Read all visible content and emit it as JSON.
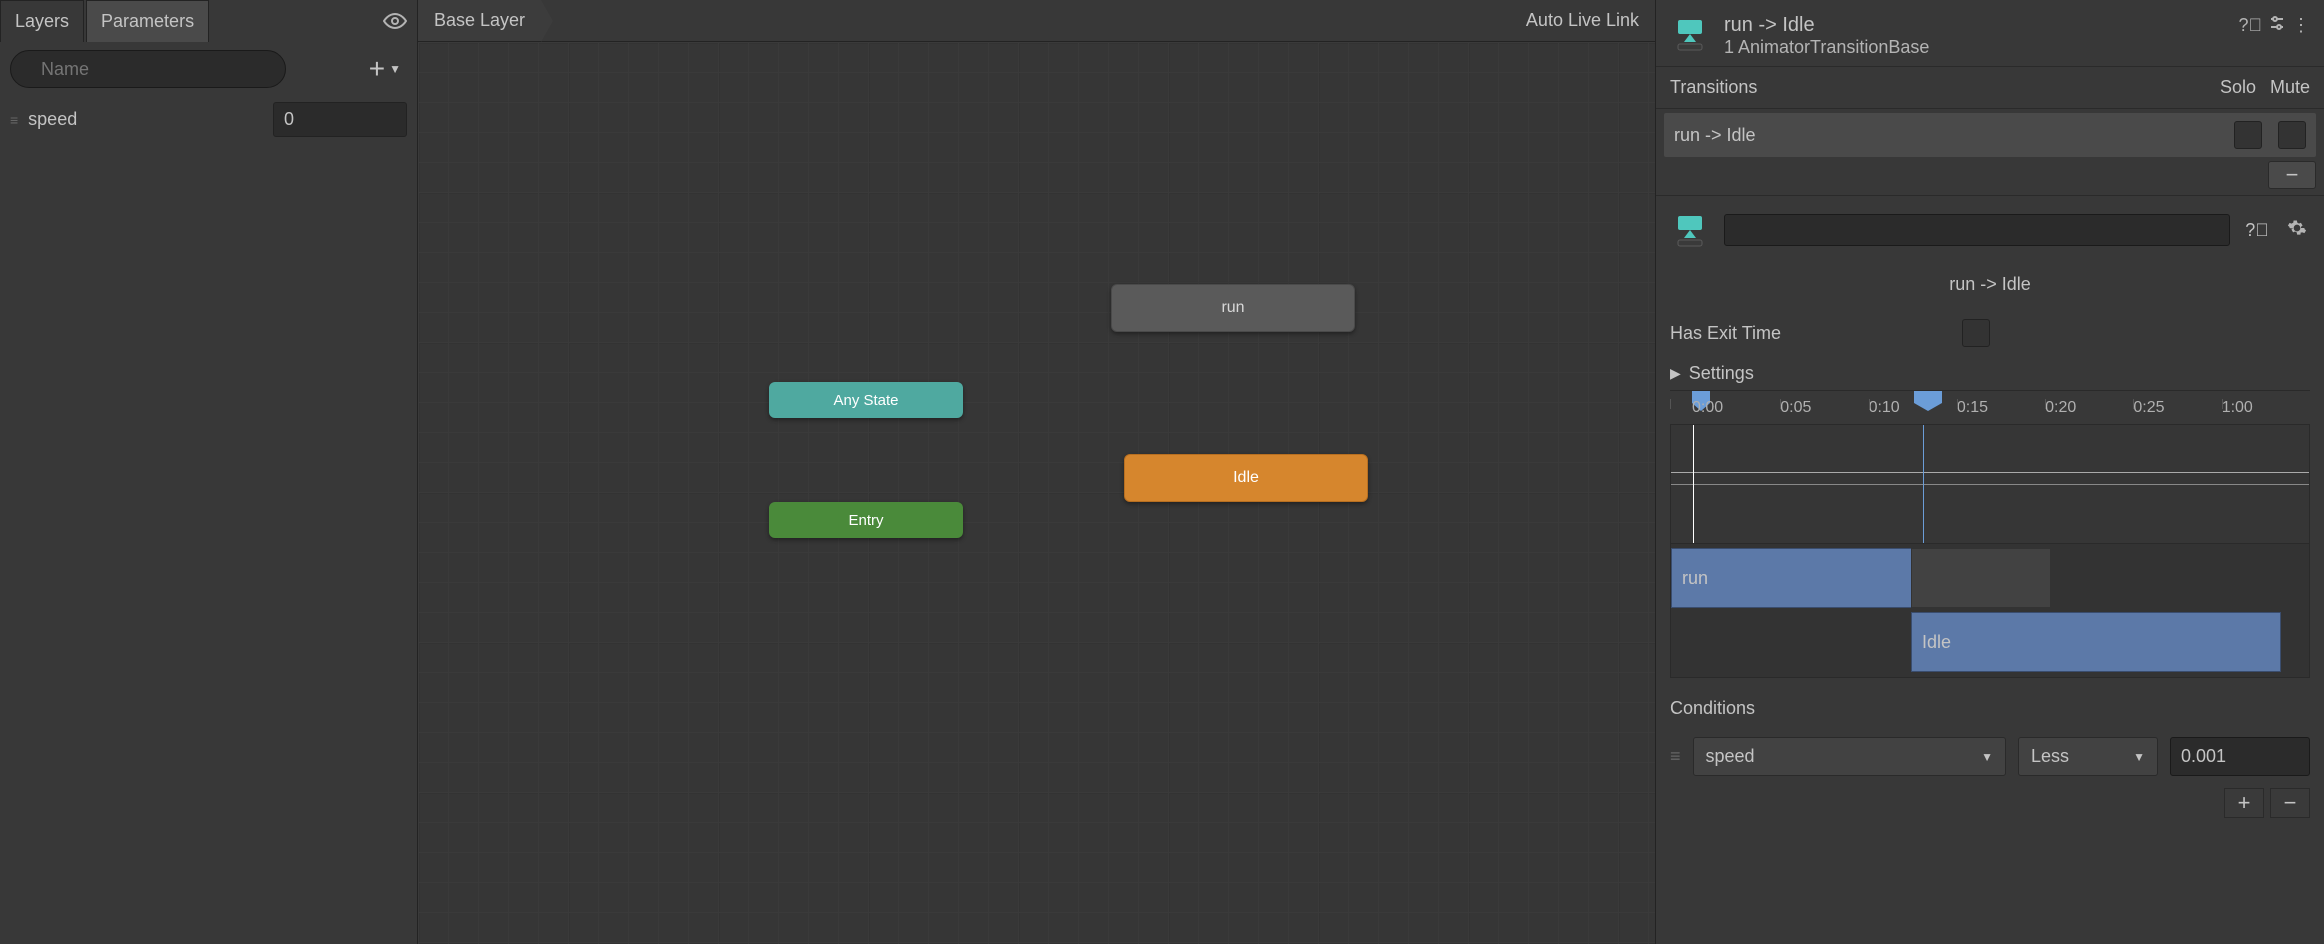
{
  "left": {
    "tabs": {
      "layers": "Layers",
      "parameters": "Parameters"
    },
    "search_placeholder": "Name",
    "add_label": "+",
    "params": [
      {
        "name": "speed",
        "value": "0"
      }
    ]
  },
  "canvas": {
    "breadcrumb": "Base Layer",
    "live_link": "Auto Live Link",
    "nodes": {
      "run": "run",
      "any_state": "Any State",
      "idle": "Idle",
      "entry": "Entry"
    }
  },
  "inspector": {
    "title": "run -> Idle",
    "subtitle": "1 AnimatorTransitionBase",
    "transitions_label": "Transitions",
    "solo_label": "Solo",
    "mute_label": "Mute",
    "transition_item": "run -> Idle",
    "minus": "−",
    "named_transition": "run -> Idle",
    "has_exit_time_label": "Has Exit Time",
    "settings_label": "Settings",
    "ruler": [
      "0:00",
      "0:05",
      "0:10",
      "0:15",
      "0:20",
      "0:25",
      "1:00"
    ],
    "blend_run": "run",
    "blend_idle": "Idle",
    "conditions_label": "Conditions",
    "condition": {
      "param": "speed",
      "op": "Less",
      "value": "0.001"
    },
    "plus": "+"
  }
}
